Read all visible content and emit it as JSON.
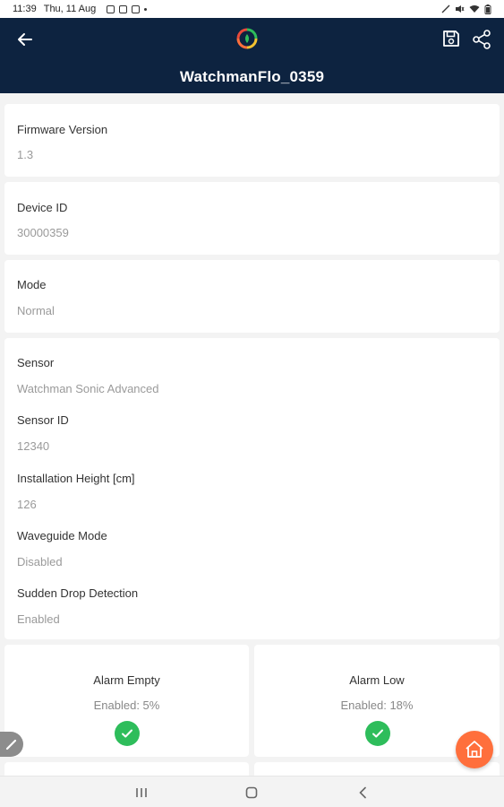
{
  "status_bar": {
    "time": "11:39",
    "date": "Thu, 11 Aug"
  },
  "app_bar": {
    "title": "WatchmanFlo_0359"
  },
  "info": {
    "firmware_label": "Firmware Version",
    "firmware_value": "1.3",
    "device_id_label": "Device ID",
    "device_id_value": "30000359",
    "mode_label": "Mode",
    "mode_value": "Normal"
  },
  "sensor": {
    "sensor_label": "Sensor",
    "sensor_value": "Watchman Sonic Advanced",
    "sensor_id_label": "Sensor ID",
    "sensor_id_value": "12340",
    "install_height_label": "Installation Height [cm]",
    "install_height_value": "126",
    "waveguide_label": "Waveguide Mode",
    "waveguide_value": "Disabled",
    "sudden_drop_label": "Sudden Drop Detection",
    "sudden_drop_value": "Enabled"
  },
  "alarms": [
    {
      "label": "Alarm Empty",
      "value": "Enabled: 5%"
    },
    {
      "label": "Alarm Low",
      "value": "Enabled: 18%"
    }
  ],
  "colors": {
    "app_bar": "#0d2340",
    "check": "#2ebd5b",
    "home_fab": "#ff6f3c"
  },
  "icons": [
    "back-arrow-icon",
    "app-logo-icon",
    "save-icon",
    "share-icon",
    "check-icon",
    "pencil-icon",
    "home-icon",
    "recents-icon",
    "home-nav-icon",
    "back-nav-icon"
  ]
}
